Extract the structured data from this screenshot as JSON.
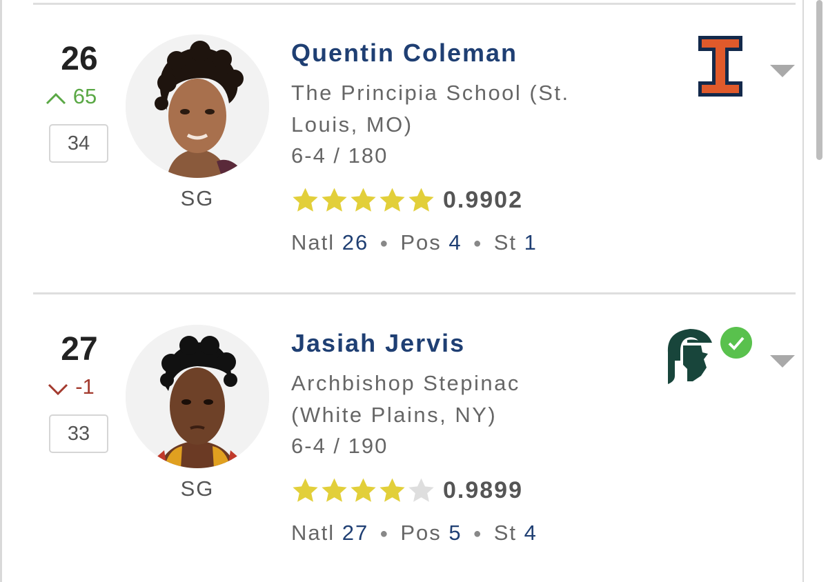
{
  "players": [
    {
      "rank": "26",
      "movement_direction": "up",
      "movement": "65",
      "position_rank": "34",
      "position": "SG",
      "name": "Quentin Coleman",
      "school_line1": "The Principia School (St.",
      "school_line2": "Louis, MO)",
      "size": "6-4 / 180",
      "stars": 5,
      "rating": "0.9902",
      "natl_label": "Natl",
      "natl": "26",
      "pos_label": "Pos",
      "pos": "4",
      "st_label": "St",
      "st": "1",
      "team_logo": "illinois-logo",
      "committed": false
    },
    {
      "rank": "27",
      "movement_direction": "down",
      "movement": "-1",
      "position_rank": "33",
      "position": "SG",
      "name": "Jasiah Jervis",
      "school_line1": "Archbishop Stepinac",
      "school_line2": "(White Plains, NY)",
      "size": "6-4 / 190",
      "stars": 4,
      "rating": "0.9899",
      "natl_label": "Natl",
      "natl": "27",
      "pos_label": "Pos",
      "pos": "5",
      "st_label": "St",
      "st": "4",
      "team_logo": "michigan-state-spartan-logo",
      "committed": true
    }
  ],
  "colors": {
    "name": "#1f3f73",
    "up": "#5aa845",
    "down": "#a33a2e",
    "star_filled": "#e2cf3a",
    "star_empty": "#dedede",
    "illinois_orange": "#e05a2b",
    "illinois_navy": "#13294b",
    "msu_green": "#18453b",
    "check_green": "#59c14d"
  }
}
